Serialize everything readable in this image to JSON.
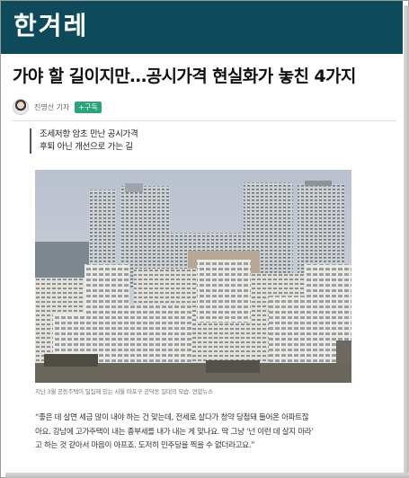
{
  "masthead": {
    "logo_text": "한겨레",
    "background": "#0f4a5a"
  },
  "article": {
    "headline": "가야 할 길이지만…공시가격 현실화가 놓친 4가지",
    "byline": {
      "reporter": "진명선 기자",
      "subscribe_label": "+구독",
      "subscribe_color": "#2aa57a"
    },
    "subheads": [
      "조세저항 암초 만난 공시가격",
      "후퇴 아닌 개선으로 가는 길"
    ],
    "photo": {
      "icon": "apartment-photo"
    },
    "caption": "지난 3월 공동주택이 밀집해 있는 서울 마포구 공덕동 일대의 모습. 연합뉴스",
    "body_lines": [
      "“좋은 데 살면 세금 많이 내야 하는 건 맞는데, 전세로 살다가 청약 당첨돼 들어온 아파트잖",
      "아요. 강남에 고가주택이 내는 종부세를 내가 내는 게 맞나요. 딱 그냥 ‘넌 이런 데 살지 마라’",
      "고 하는 것 같아서 마음이 아프죠. 도저히 민주당을 찍을 수 없더라고요.”"
    ]
  }
}
